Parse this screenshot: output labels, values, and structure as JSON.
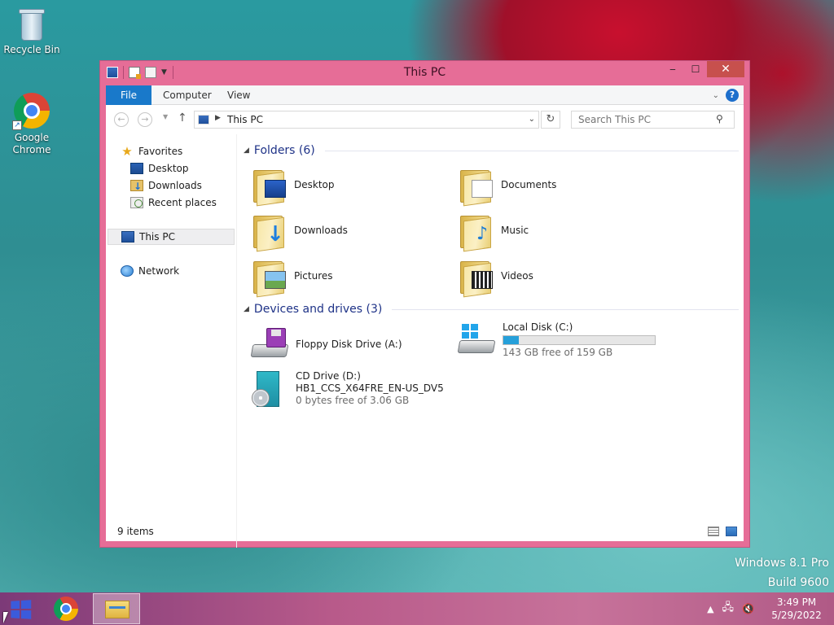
{
  "desktop": {
    "icons": [
      {
        "label": "Recycle Bin"
      },
      {
        "label": "Google Chrome"
      }
    ],
    "watermark": {
      "line1": "Windows 8.1 Pro",
      "line2": "Build 9600"
    }
  },
  "window": {
    "title": "This PC",
    "controls": {
      "minimize": "‒",
      "maximize": "☐",
      "close": "✕"
    },
    "ribbon": {
      "tabs": [
        "File",
        "Computer",
        "View"
      ]
    },
    "address": {
      "path": "This PC"
    },
    "search": {
      "placeholder": "Search This PC"
    },
    "nav_pane": {
      "favorites": "Favorites",
      "favorites_items": [
        "Desktop",
        "Downloads",
        "Recent places"
      ],
      "this_pc": "This PC",
      "network": "Network"
    },
    "folders_header": "Folders (6)",
    "folders": [
      {
        "name": "Desktop",
        "icon": "desktop-folder-icon"
      },
      {
        "name": "Documents",
        "icon": "documents-folder-icon"
      },
      {
        "name": "Downloads",
        "icon": "downloads-folder-icon"
      },
      {
        "name": "Music",
        "icon": "music-folder-icon"
      },
      {
        "name": "Pictures",
        "icon": "pictures-folder-icon"
      },
      {
        "name": "Videos",
        "icon": "videos-folder-icon"
      }
    ],
    "devices_header": "Devices and drives (3)",
    "drives": [
      {
        "name": "Floppy Disk Drive (A:)"
      },
      {
        "name": "Local Disk (C:)",
        "free": "143 GB free of 159 GB",
        "used_fraction": 0.1
      },
      {
        "name": "CD Drive (D:)",
        "label": "HB1_CCS_X64FRE_EN-US_DV5",
        "free": "0 bytes free of 3.06 GB"
      }
    ],
    "status": "9 items"
  },
  "taskbar": {
    "clock_time": "3:49 PM",
    "clock_date": "5/29/2022"
  },
  "colors": {
    "window_frame": "#e66d97",
    "file_tab": "#1979ca",
    "close_button": "#c7504d",
    "storage_bar": "#26a0da"
  }
}
